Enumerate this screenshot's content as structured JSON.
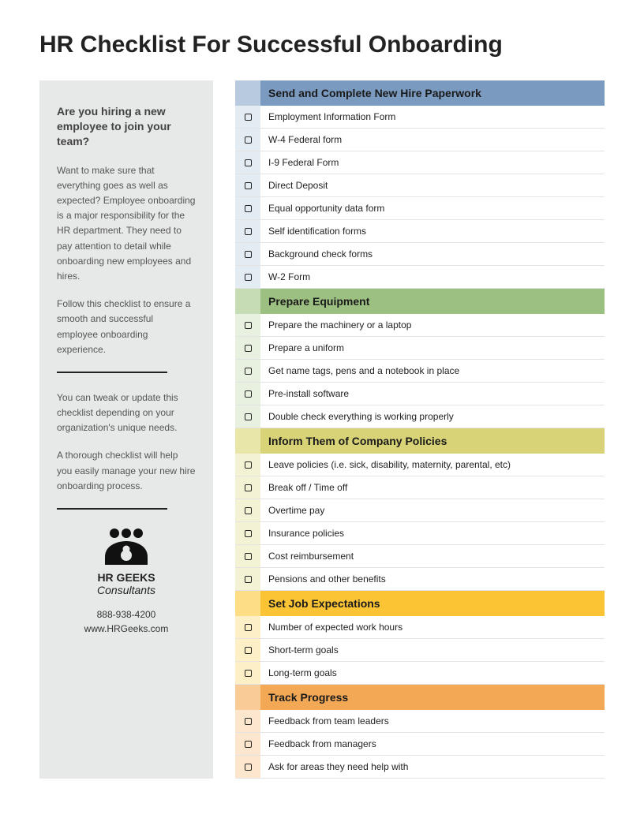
{
  "title": "HR Checklist For Successful Onboarding",
  "sidebar": {
    "heading": "Are you hiring a new employee to join your team?",
    "p1": "Want to make sure that everything goes as well as expected? Employee onboarding is a major responsibility for the HR department. They need to pay attention to detail while onboarding new employees and hires.",
    "p2": "Follow this checklist to ensure a smooth and successful employee onboarding experience.",
    "p3": "You can tweak or update this checklist depending on your organization's unique needs.",
    "p4": "A thorough checklist will help you easily manage your new hire onboarding process.",
    "logo_name": "HR GEEKS",
    "logo_sub": "Consultants",
    "phone": "888-938-4200",
    "website": "www.HRGeeks.com"
  },
  "sections": [
    {
      "title": "Send and Complete New Hire Paperwork",
      "items": [
        "Employment Information Form",
        "W-4 Federal form",
        "I-9 Federal Form",
        "Direct Deposit",
        "Equal opportunity data form",
        "Self identification forms",
        "Background check forms",
        "W-2 Form"
      ]
    },
    {
      "title": "Prepare Equipment",
      "items": [
        "Prepare the machinery or a laptop",
        "Prepare a uniform",
        "Get name tags, pens and a notebook in place",
        "Pre-install software",
        "Double check everything is working properly"
      ]
    },
    {
      "title": "Inform Them of Company Policies",
      "items": [
        "Leave policies (i.e. sick, disability, maternity, parental, etc)",
        "Break off / Time off",
        "Overtime pay",
        "Insurance policies",
        "Cost reimbursement",
        "Pensions and other benefits"
      ]
    },
    {
      "title": "Set Job Expectations",
      "items": [
        "Number of expected work hours",
        "Short-term goals",
        "Long-term goals"
      ]
    },
    {
      "title": "Track Progress",
      "items": [
        "Feedback from team leaders",
        "Feedback from managers",
        "Ask for areas they need help with"
      ]
    }
  ]
}
